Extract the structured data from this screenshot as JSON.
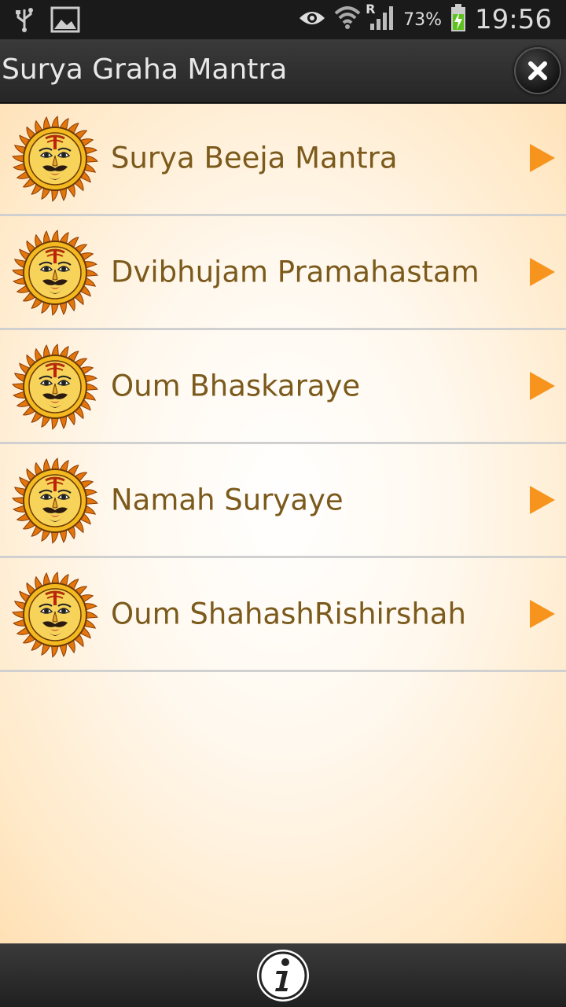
{
  "status_bar": {
    "icons": [
      "usb-icon",
      "image-icon",
      "eye-icon",
      "wifi-icon",
      "signal-icon",
      "battery-icon"
    ],
    "roaming": "R",
    "battery": "73%",
    "time": "19:56"
  },
  "title_bar": {
    "title": "Surya Graha Mantra",
    "close_icon": "close-icon"
  },
  "list": {
    "items": [
      {
        "label": "Surya Beeja Mantra",
        "icon": "sun-face-icon",
        "action_icon": "play-icon"
      },
      {
        "label": "Dvibhujam Pramahastam",
        "icon": "sun-face-icon",
        "action_icon": "play-icon"
      },
      {
        "label": "Oum Bhaskaraye",
        "icon": "sun-face-icon",
        "action_icon": "play-icon"
      },
      {
        "label": "Namah Suryaye",
        "icon": "sun-face-icon",
        "action_icon": "play-icon"
      },
      {
        "label": "Oum ShahashRishirshah",
        "icon": "sun-face-icon",
        "action_icon": "play-icon"
      }
    ]
  },
  "bottom_bar": {
    "info_icon": "info-icon"
  },
  "colors": {
    "accent_orange": "#f7941d",
    "label_brown": "#7b5a1c",
    "bar_dark": "#2a2a2a"
  }
}
